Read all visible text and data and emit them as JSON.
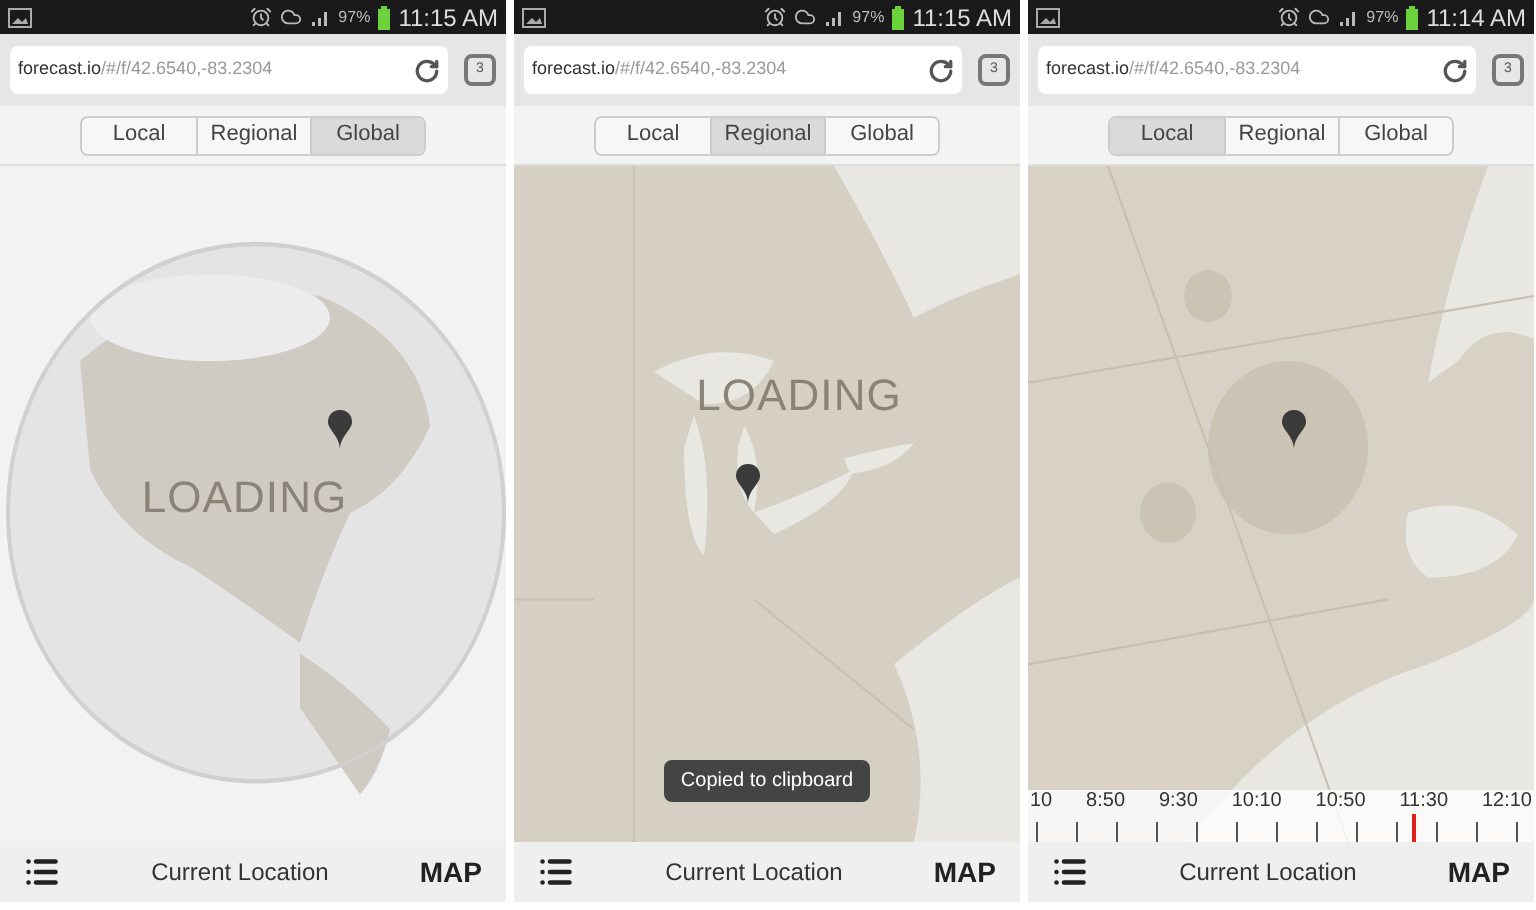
{
  "screens": [
    {
      "status": {
        "battery": "97%",
        "time": "11:15 AM"
      },
      "url": {
        "host": "forecast.io",
        "path": "/#/f/42.6540,-83.2304"
      },
      "tab_count": "3",
      "tabs": [
        {
          "label": "Local",
          "selected": false
        },
        {
          "label": "Regional",
          "selected": false
        },
        {
          "label": "Global",
          "selected": true
        }
      ],
      "map": {
        "kind": "globe",
        "overlay": "LOADING"
      },
      "bottom": {
        "title": "Current Location",
        "action": "MAP"
      }
    },
    {
      "status": {
        "battery": "97%",
        "time": "11:15 AM"
      },
      "url": {
        "host": "forecast.io",
        "path": "/#/f/42.6540,-83.2304"
      },
      "tab_count": "3",
      "tabs": [
        {
          "label": "Local",
          "selected": false
        },
        {
          "label": "Regional",
          "selected": true
        },
        {
          "label": "Global",
          "selected": false
        }
      ],
      "map": {
        "kind": "regional",
        "overlay": "LOADING"
      },
      "toast": "Copied to clipboard",
      "bottom": {
        "title": "Current Location",
        "action": "MAP"
      }
    },
    {
      "status": {
        "battery": "97%",
        "time": "11:14 AM"
      },
      "url": {
        "host": "forecast.io",
        "path": "/#/f/42.6540,-83.2304"
      },
      "tab_count": "3",
      "tabs": [
        {
          "label": "Local",
          "selected": true
        },
        {
          "label": "Regional",
          "selected": false
        },
        {
          "label": "Global",
          "selected": false
        }
      ],
      "map": {
        "kind": "local"
      },
      "timeline": {
        "labels": [
          "10",
          "8:50",
          "9:30",
          "10:10",
          "10:50",
          "11:30",
          "12:10"
        ],
        "level": 0.76
      },
      "bottom": {
        "title": "Current Location",
        "action": "MAP"
      }
    }
  ]
}
